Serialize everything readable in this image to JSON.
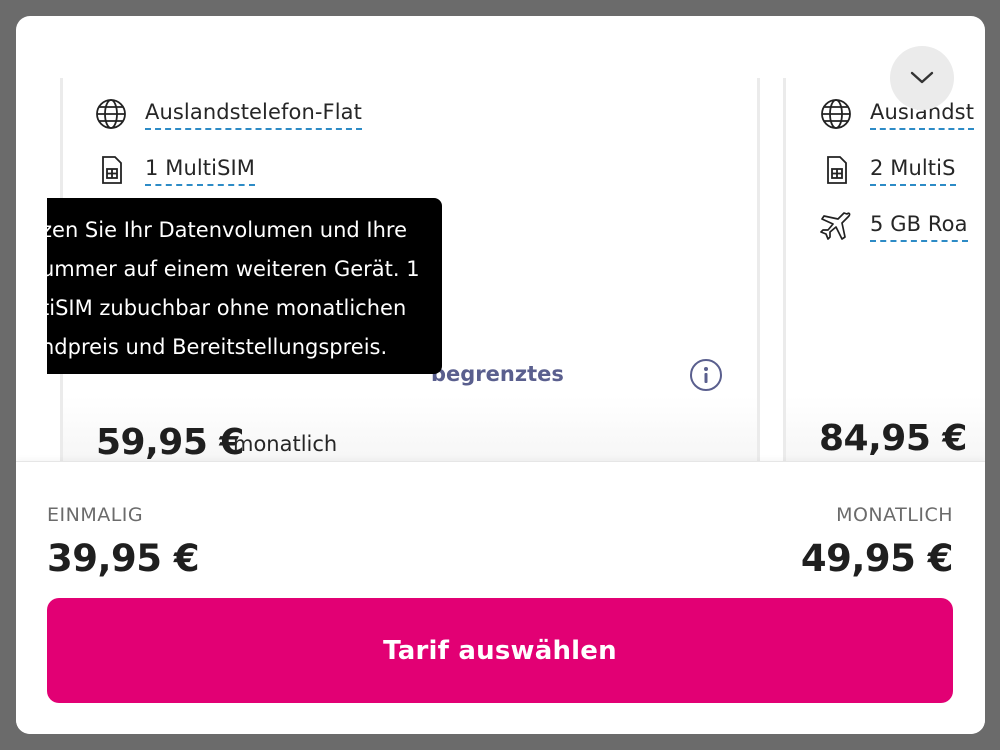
{
  "plans": [
    {
      "features": [
        {
          "icon": "globe-icon",
          "label": "Auslandstelefon-Flat"
        },
        {
          "icon": "sim-card-icon",
          "label": "1 MultiSIM"
        }
      ],
      "unlimited_text": "begrenztes",
      "price": "59,95 €",
      "price_note": "monatlich"
    },
    {
      "features": [
        {
          "icon": "globe-icon",
          "label": "Auslandst"
        },
        {
          "icon": "sim-card-icon",
          "label": "2 MultiS"
        },
        {
          "icon": "airplane-icon",
          "label": "5 GB Roa"
        }
      ],
      "price": "84,95 €"
    }
  ],
  "tooltip": {
    "lines": [
      "zen Sie Ihr Datenvolumen und Ihre",
      "ummer auf einem weiteren Gerät. 1",
      "tiSIM zubuchbar ohne monatlichen",
      "ndpreis und Bereitstellungspreis."
    ]
  },
  "footer": {
    "one_time_label": "EINMALIG",
    "one_time_price": "39,95 €",
    "monthly_label": "MONATLICH",
    "monthly_price": "49,95 €",
    "cta_label": "Tarif auswählen"
  },
  "colors": {
    "brand": "#e20074",
    "link_underline": "#2d8bc6",
    "info_accent": "#5a5f8e"
  }
}
